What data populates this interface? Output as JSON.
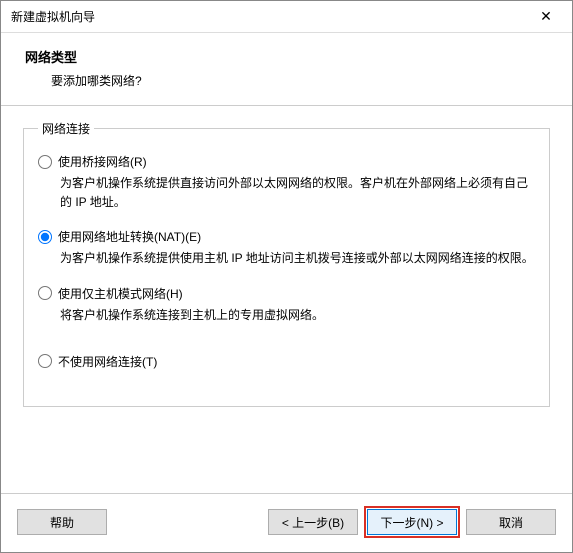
{
  "window": {
    "title": "新建虚拟机向导",
    "close_glyph": "✕"
  },
  "header": {
    "heading": "网络类型",
    "subheading": "要添加哪类网络?"
  },
  "group": {
    "legend": "网络连接",
    "options": [
      {
        "label": "使用桥接网络(R)",
        "desc": "为客户机操作系统提供直接访问外部以太网网络的权限。客户机在外部网络上必须有自己的 IP 地址。",
        "checked": false
      },
      {
        "label": "使用网络地址转换(NAT)(E)",
        "desc": "为客户机操作系统提供使用主机 IP 地址访问主机拨号连接或外部以太网网络连接的权限。",
        "checked": true
      },
      {
        "label": "使用仅主机模式网络(H)",
        "desc": "将客户机操作系统连接到主机上的专用虚拟网络。",
        "checked": false
      },
      {
        "label": "不使用网络连接(T)",
        "desc": "",
        "checked": false
      }
    ]
  },
  "footer": {
    "help": "帮助",
    "back": "< 上一步(B)",
    "next": "下一步(N) >",
    "cancel": "取消"
  }
}
